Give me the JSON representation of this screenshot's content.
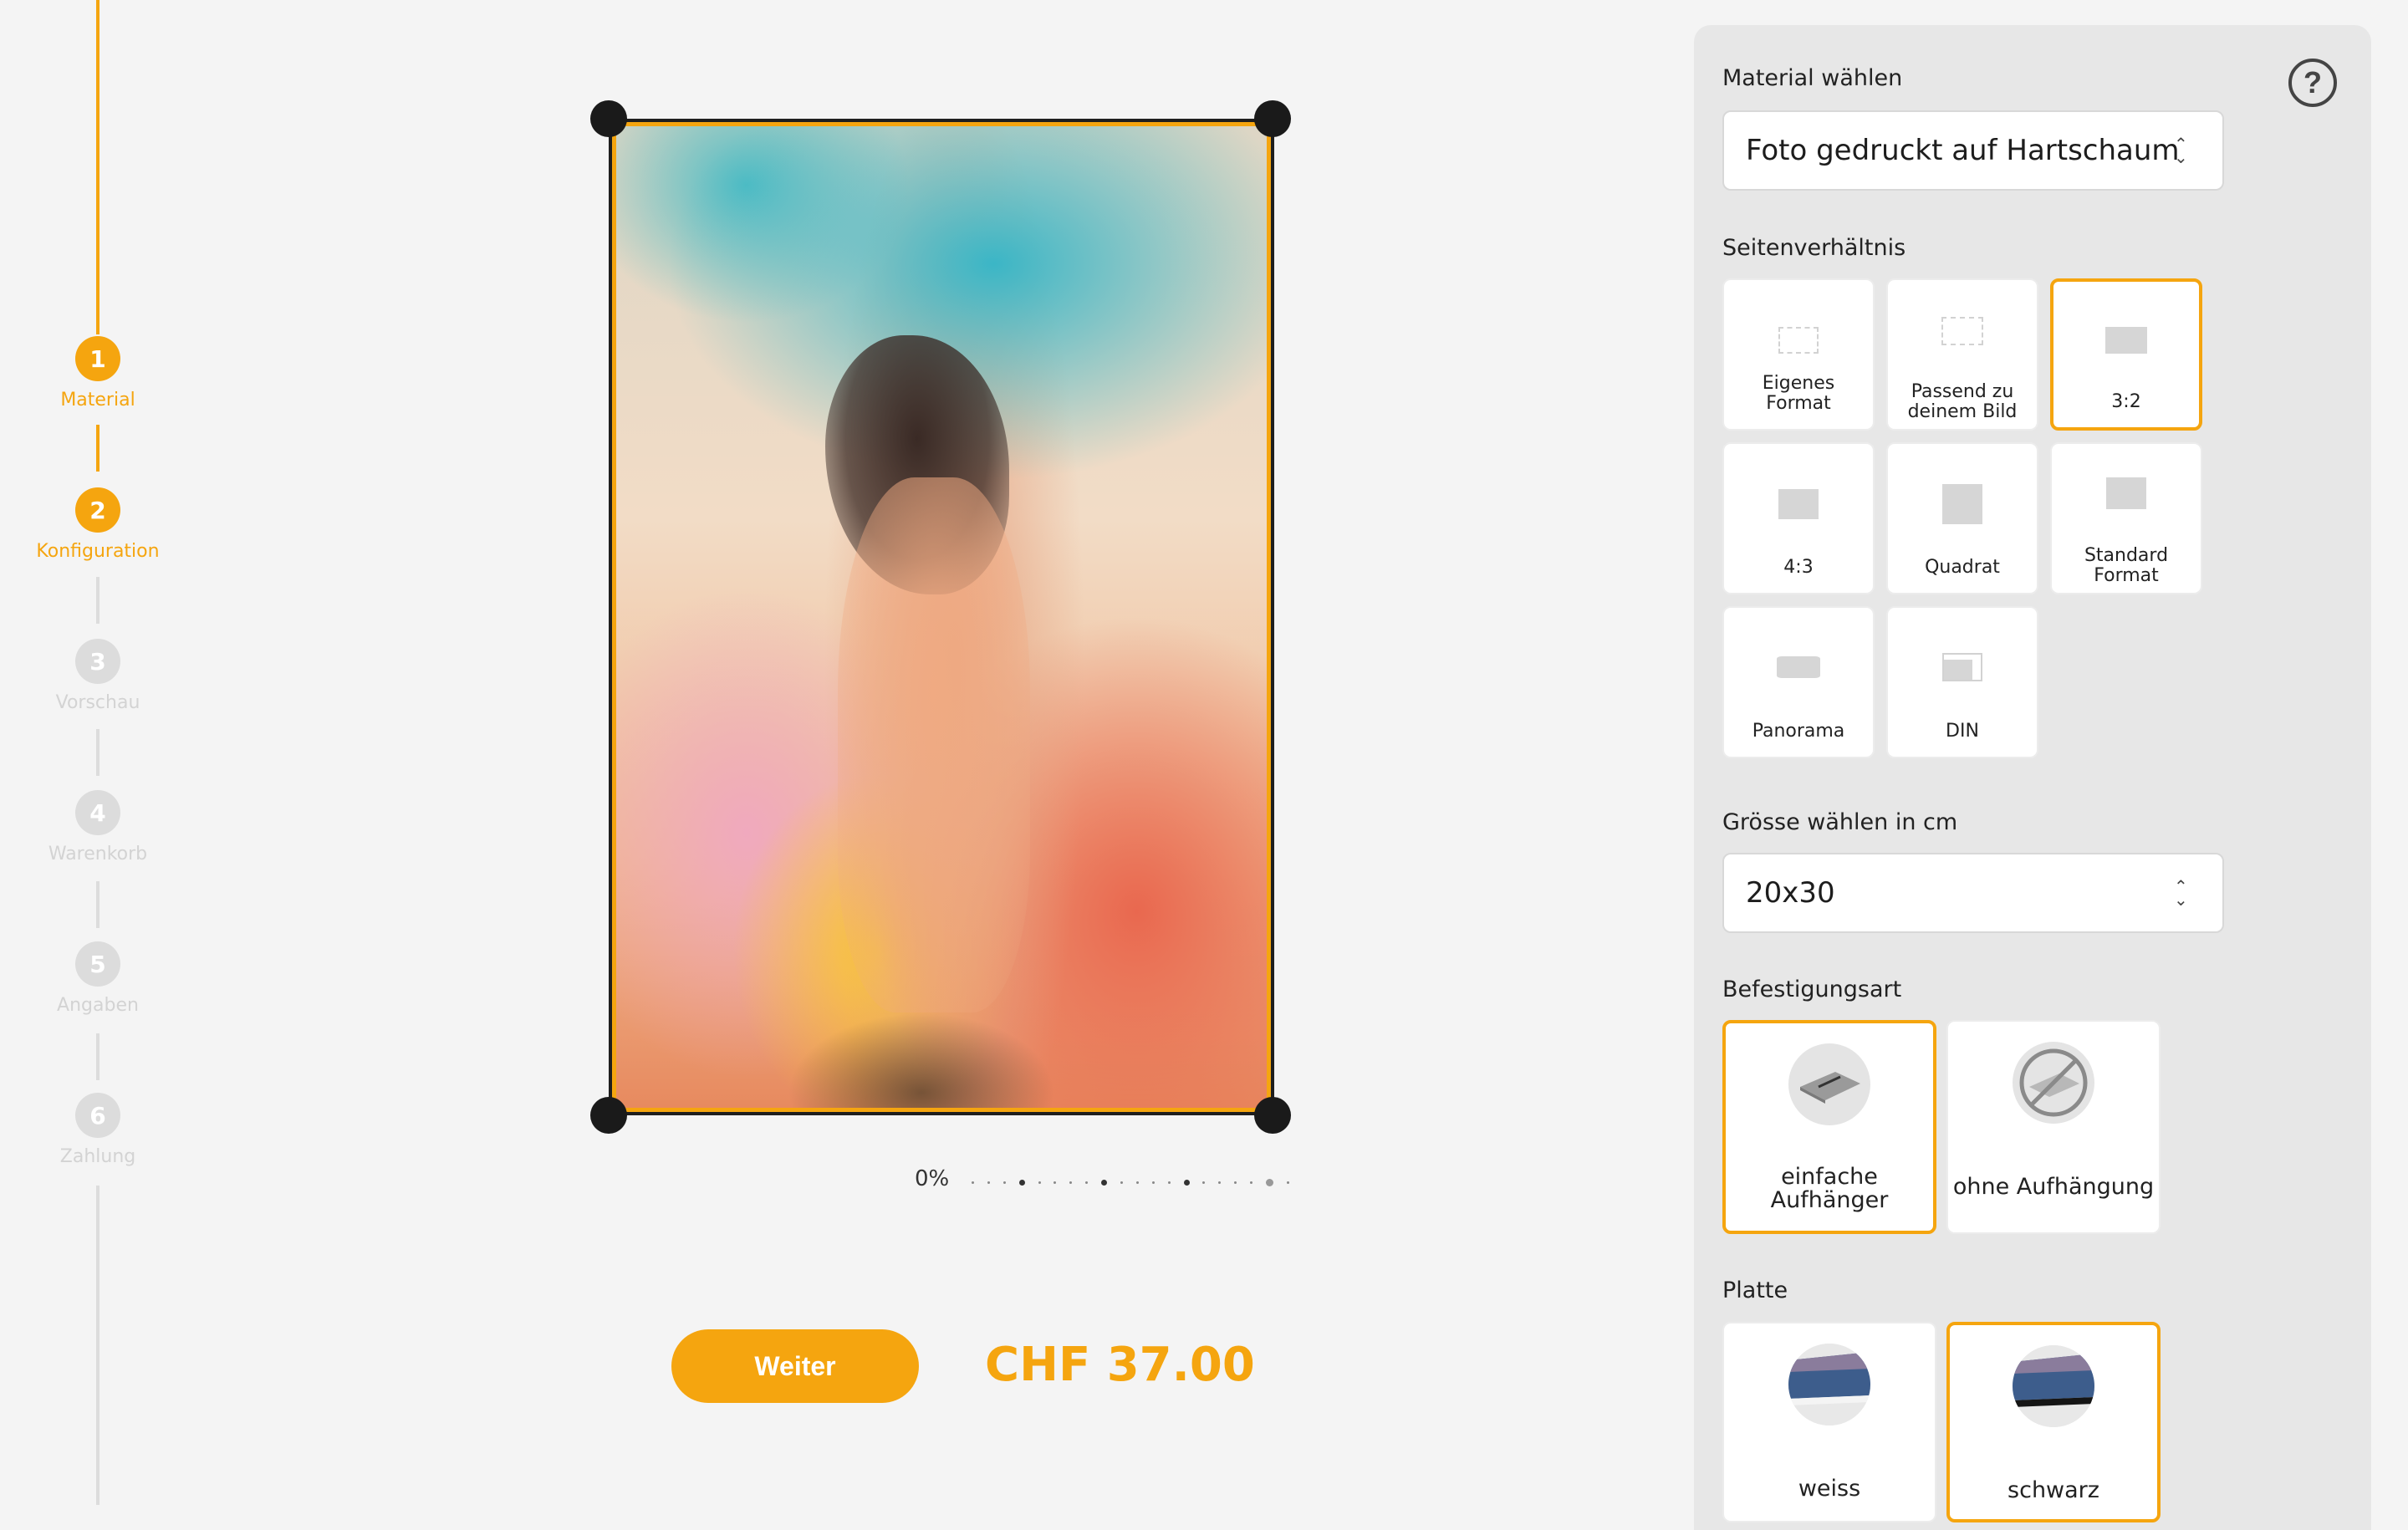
{
  "stepper": {
    "steps": [
      {
        "number": "1",
        "label": "Material",
        "state": "active"
      },
      {
        "number": "2",
        "label": "Konfiguration",
        "state": "active"
      },
      {
        "number": "3",
        "label": "Vorschau",
        "state": "inactive"
      },
      {
        "number": "4",
        "label": "Warenkorb",
        "state": "inactive"
      },
      {
        "number": "5",
        "label": "Angaben",
        "state": "inactive"
      },
      {
        "number": "6",
        "label": "Zahlung",
        "state": "inactive"
      }
    ]
  },
  "preview": {
    "zoom_label": "0%",
    "zoom_level": 0
  },
  "footer": {
    "next_label": "Weiter",
    "price": "CHF 37.00"
  },
  "config": {
    "help_icon": "?",
    "material": {
      "title": "Material wählen",
      "selected": "Foto gedruckt auf Hartschaum"
    },
    "aspect": {
      "title": "Seitenverhältnis",
      "options": [
        {
          "label": "Eigenes Format",
          "icon": "custom-format-icon",
          "selected": false
        },
        {
          "label": "Passend zu deinem Bild",
          "icon": "fit-image-icon",
          "selected": false
        },
        {
          "label": "3:2",
          "icon": "ratio-3-2-icon",
          "selected": true
        },
        {
          "label": "4:3",
          "icon": "ratio-4-3-icon",
          "selected": false
        },
        {
          "label": "Quadrat",
          "icon": "square-icon",
          "selected": false
        },
        {
          "label": "Standard Format",
          "icon": "standard-format-icon",
          "selected": false
        },
        {
          "label": "Panorama",
          "icon": "panorama-icon",
          "selected": false
        },
        {
          "label": "DIN",
          "icon": "din-icon",
          "selected": false
        }
      ]
    },
    "size": {
      "title": "Grösse wählen in cm",
      "selected": "20x30"
    },
    "mounting": {
      "title": "Befestigungsart",
      "options": [
        {
          "label": "einfache Aufhänger",
          "icon": "hanger-icon",
          "selected": true
        },
        {
          "label": "ohne Aufhängung",
          "icon": "no-hanger-icon",
          "selected": false
        }
      ]
    },
    "plate": {
      "title": "Platte",
      "options": [
        {
          "label": "weiss",
          "icon": "white-plate-icon",
          "selected": false
        },
        {
          "label": "schwarz",
          "icon": "black-plate-icon",
          "selected": true
        }
      ]
    }
  },
  "colors": {
    "accent": "#f5a50f",
    "inactive": "#dcdcdc",
    "panel_bg": "#e7e7e7",
    "page_bg": "#f4f4f4"
  }
}
